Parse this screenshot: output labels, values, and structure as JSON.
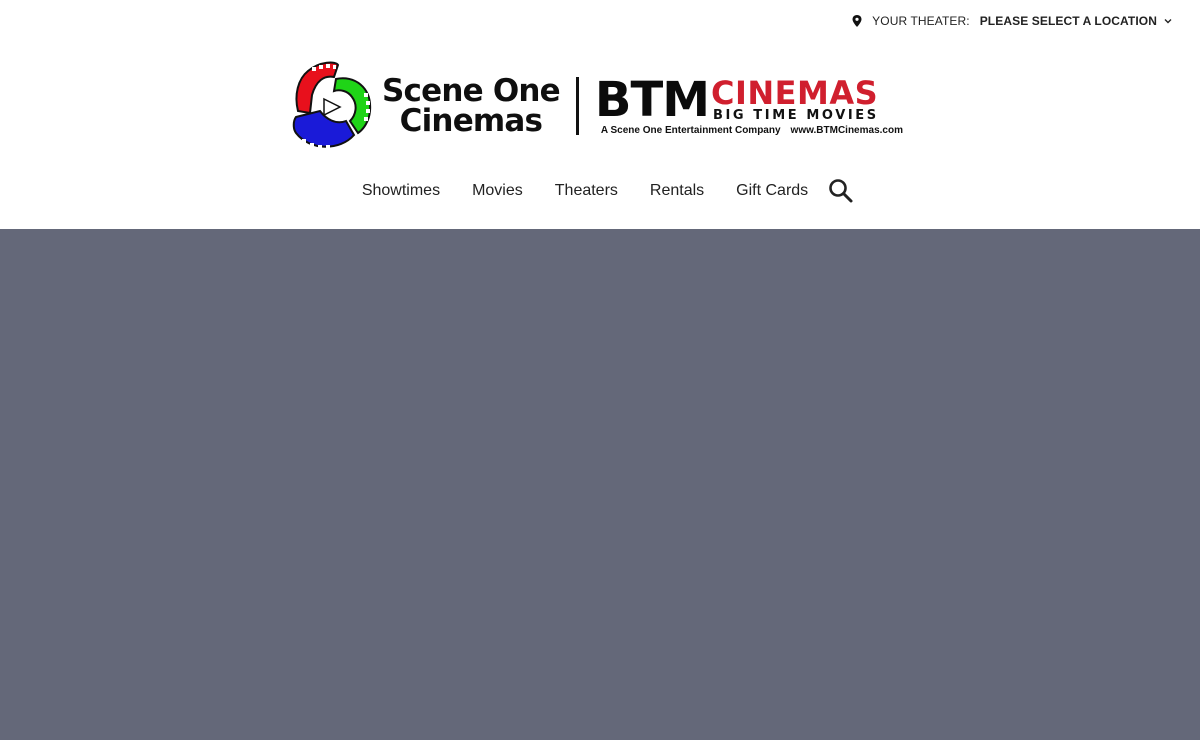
{
  "header": {
    "theater_label": "YOUR THEATER:",
    "theater_value": "PLEASE SELECT A LOCATION",
    "pin_icon": "map-pin-icon",
    "chevron_icon": "chevron-down-icon"
  },
  "logo": {
    "brand1_line1": "Scene One",
    "brand1_line2": "Cinemas",
    "brand2_btm": "BTM",
    "brand2_cinemas": "CINEMAS",
    "brand2_tagline": "BIG TIME MOVIES",
    "brand2_company": "A Scene One Entertainment Company",
    "brand2_url": "www.BTMCinemas.com",
    "colors": {
      "reel_red": "#e8101c",
      "reel_green": "#1fd417",
      "reel_blue": "#1a1ad8",
      "cinemas_red": "#d01f2e"
    }
  },
  "nav": {
    "items": [
      {
        "label": "Showtimes"
      },
      {
        "label": "Movies"
      },
      {
        "label": "Theaters"
      },
      {
        "label": "Rentals"
      },
      {
        "label": "Gift Cards"
      }
    ],
    "search_icon": "search-icon"
  },
  "hero": {
    "background": "#646879"
  }
}
